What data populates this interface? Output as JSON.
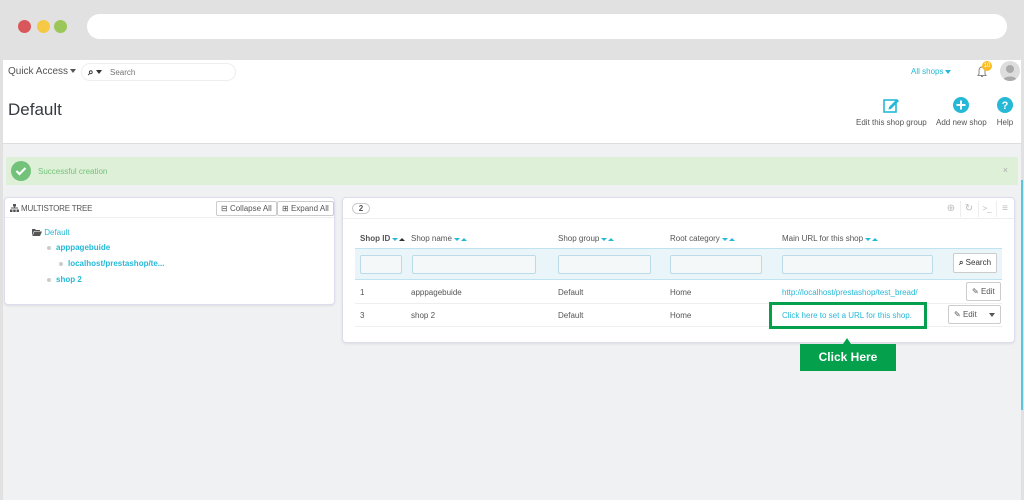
{
  "browser": {
    "window_controls": [
      "close",
      "minimize",
      "maximize"
    ]
  },
  "topbar": {
    "quick_access_label": "Quick Access",
    "search_placeholder": "Search",
    "shop_selector_label": "All shops",
    "notifications_count": "10"
  },
  "header": {
    "title": "Default",
    "toolbar": [
      {
        "label": "Edit this shop group",
        "icon": "edit-icon"
      },
      {
        "label": "Add new shop",
        "icon": "plus-circle-icon"
      },
      {
        "label": "Help",
        "icon": "help-icon"
      }
    ]
  },
  "alert": {
    "message": "Successful creation",
    "close_label": "×",
    "color": "#72c279"
  },
  "tree": {
    "title": "MULTISTORE TREE",
    "collapse_label": "Collapse All",
    "expand_label": "Expand All",
    "nodes": [
      {
        "label": "Default",
        "level": 0
      },
      {
        "label": "apppagebuide",
        "level": 1
      },
      {
        "label": "localhost/prestashop/te...",
        "level": 2
      },
      {
        "label": "shop 2",
        "level": 1
      }
    ]
  },
  "list": {
    "count": "2",
    "columns": [
      {
        "label": "Shop ID"
      },
      {
        "label": "Shop name"
      },
      {
        "label": "Shop group"
      },
      {
        "label": "Root category"
      },
      {
        "label": "Main URL for this shop"
      }
    ],
    "search_label": "Search",
    "rows": [
      {
        "id": "1",
        "name": "apppagebuide",
        "group": "Default",
        "root": "Home",
        "url": "http://localhost/prestashop/test_bread/",
        "action": "Edit"
      },
      {
        "id": "3",
        "name": "shop 2",
        "group": "Default",
        "root": "Home",
        "url": "Click here to set a URL for this shop.",
        "action": "Edit"
      }
    ]
  },
  "annotation": {
    "label": "Click Here",
    "color": "#04a04c"
  },
  "colors": {
    "accent": "#25b9d7",
    "success_bg": "#dff0d8"
  }
}
